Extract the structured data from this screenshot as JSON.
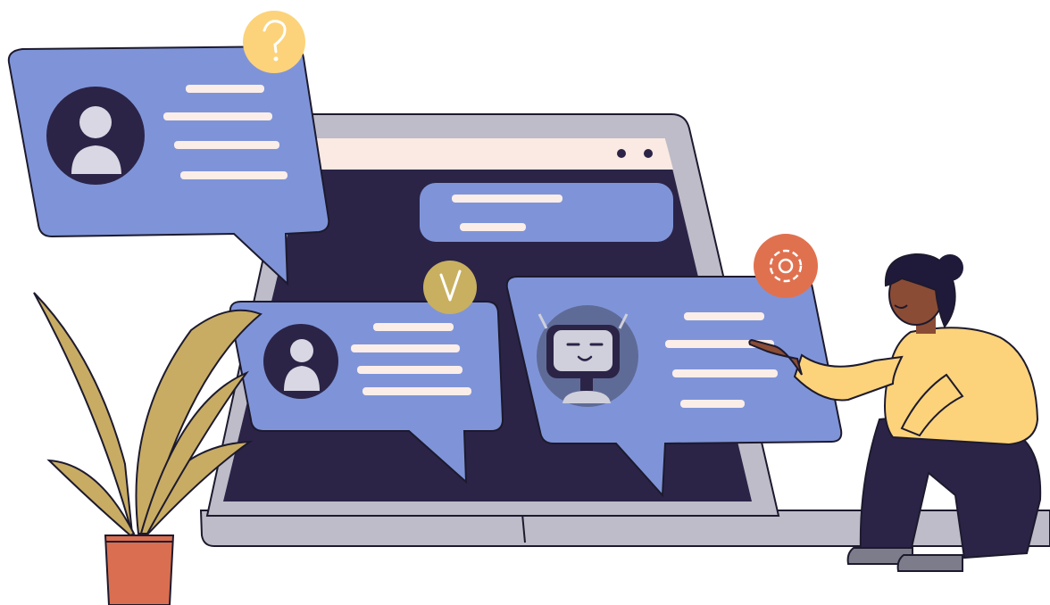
{
  "scene": {
    "subject": "chat-support-illustration",
    "palette": {
      "background": "#ffffff",
      "laptop_frame": "#bdbcc8",
      "screen_dark": "#2b2447",
      "browser_bar": "#fbe9e3",
      "bubble_blue": "#7f94d8",
      "outline": "#1d1a2e",
      "text_line": "#fbeee9",
      "question_badge": "#fcd37a",
      "check_badge": "#c8b060",
      "gear_badge": "#e0714f",
      "plant_leaf": "#c8ac63",
      "pot": "#d96f50",
      "skin": "#8b4c35",
      "hair": "#1f1a3a",
      "sweater": "#fcd37a",
      "pants": "#2b2447",
      "shoes": "#7d7c8a",
      "avatar_bg": "#2b2447",
      "avatar_person": "#d8d7e3",
      "robot_body": "#2b2447",
      "robot_face": "#cfd0db"
    },
    "icons": {
      "question_badge": "question-mark",
      "check_badge": "check-mark",
      "gear_badge": "gear",
      "user_avatar": "user-silhouette",
      "bot_avatar": "robot-head"
    }
  }
}
